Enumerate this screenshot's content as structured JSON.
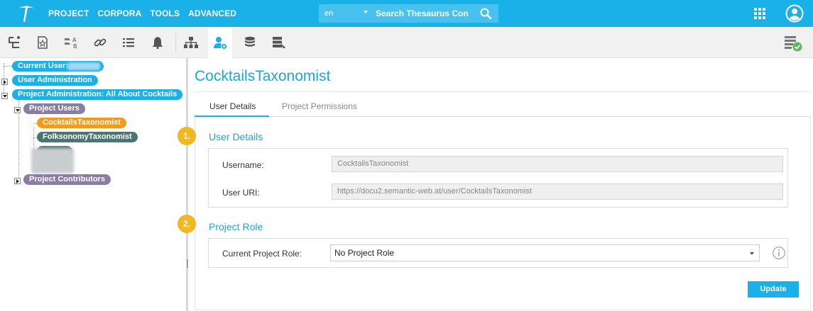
{
  "colors": {
    "primary": "#1ab0e8",
    "purple_node": "#8a7da3",
    "orange_node": "#f39a1b",
    "dark_node": "#4f7370",
    "badge": "#f2b824"
  },
  "topbar": {
    "nav": [
      "PROJECT",
      "CORPORA",
      "TOOLS",
      "ADVANCED"
    ],
    "search": {
      "language": "en",
      "placeholder": "Search Thesaurus Concepts"
    },
    "icons": [
      "logo-icon",
      "search-icon",
      "apps-grid-icon",
      "user-account-icon"
    ]
  },
  "toolbar": {
    "icons": [
      "hierarchy-tree-icon",
      "star-document-icon",
      "ab-mapping-icon",
      "link-icon",
      "list-icon",
      "bell-icon",
      "org-chart-icon",
      "user-settings-icon",
      "database-icon",
      "server-icon",
      "checked-list-icon"
    ],
    "active": "user-settings-icon"
  },
  "tree": {
    "current_user": "Current User:",
    "user_admin": "User Administration",
    "project_admin": "Project Administration: All About Cocktails",
    "project_users": "Project Users",
    "users": [
      "CocktailsTaxonomist",
      "FolksonomyTaxonomist"
    ],
    "project_contributors": "Project Contributors"
  },
  "main": {
    "title": "CocktailsTaxonomist",
    "tabs": [
      "User Details",
      "Project Permissions"
    ],
    "active_tab": "User Details",
    "section1": {
      "badge": "1.",
      "title": "User Details",
      "username_label": "Username:",
      "username_value": "CocktailsTaxonomist",
      "uri_label": "User URI:",
      "uri_value": "https://docu2.semantic-web.at/user/CocktailsTaxonomist"
    },
    "section2": {
      "badge": "2.",
      "title": "Project Role",
      "role_label": "Current Project Role:",
      "role_value": "No Project Role"
    },
    "update_button": "Update"
  }
}
